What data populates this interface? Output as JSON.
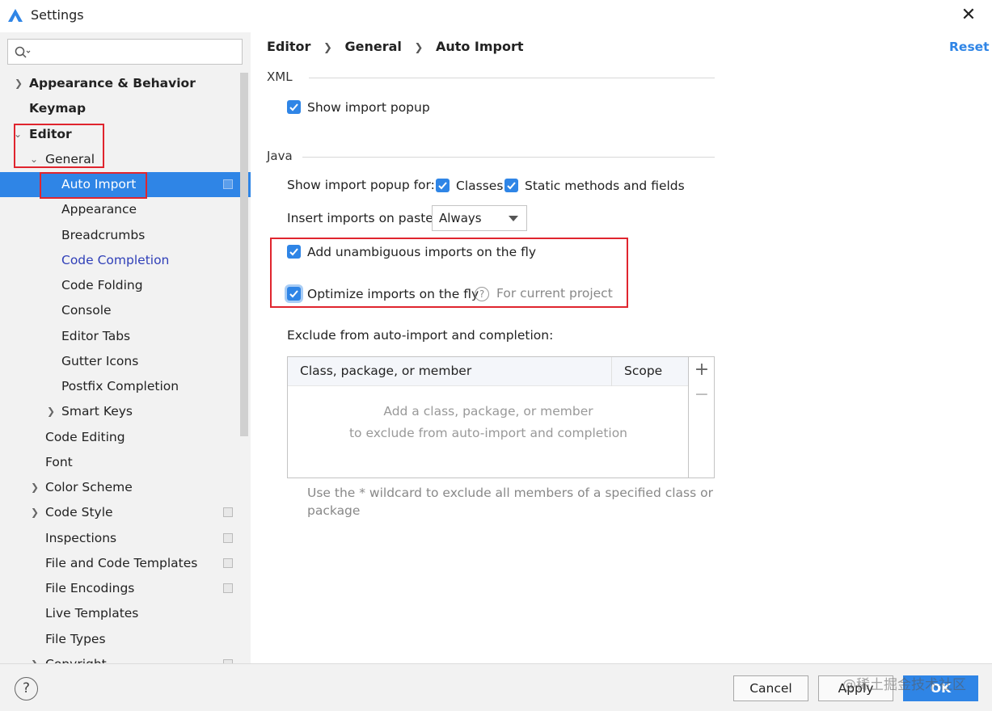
{
  "window": {
    "title": "Settings",
    "close_glyph": "✕"
  },
  "sidebar": {
    "search_placeholder": "",
    "items": [
      {
        "label": "Appearance & Behavior"
      },
      {
        "label": "Keymap"
      },
      {
        "label": "Editor"
      },
      {
        "label": "General"
      },
      {
        "label": "Auto Import"
      },
      {
        "label": "Appearance"
      },
      {
        "label": "Breadcrumbs"
      },
      {
        "label": "Code Completion"
      },
      {
        "label": "Code Folding"
      },
      {
        "label": "Console"
      },
      {
        "label": "Editor Tabs"
      },
      {
        "label": "Gutter Icons"
      },
      {
        "label": "Postfix Completion"
      },
      {
        "label": "Smart Keys"
      },
      {
        "label": "Code Editing"
      },
      {
        "label": "Font"
      },
      {
        "label": "Color Scheme"
      },
      {
        "label": "Code Style"
      },
      {
        "label": "Inspections"
      },
      {
        "label": "File and Code Templates"
      },
      {
        "label": "File Encodings"
      },
      {
        "label": "Live Templates"
      },
      {
        "label": "File Types"
      },
      {
        "label": "Copyright"
      }
    ]
  },
  "breadcrumb": [
    "Editor",
    "General",
    "Auto Import"
  ],
  "reset_label": "Reset",
  "xml": {
    "heading": "XML",
    "show_popup_label": "Show import popup"
  },
  "java": {
    "heading": "Java",
    "popup_for_label": "Show import popup for:",
    "classes_label": "Classes",
    "static_label": "Static methods and fields",
    "insert_label": "Insert imports on paste:",
    "insert_value": "Always",
    "add_unambiguous_label": "Add unambiguous imports on the fly",
    "optimize_label": "Optimize imports on the fly",
    "help_glyph": "?",
    "for_current_project": "For current project",
    "exclude_label": "Exclude from auto-import and completion:",
    "table": {
      "col1": "Class, package, or member",
      "col2": "Scope",
      "empty_line1": "Add a class, package, or member",
      "empty_line2": "to exclude from auto-import and completion",
      "add_glyph": "+",
      "remove_glyph": "−"
    },
    "hint_line1": "Use the * wildcard to exclude all members of a specified class or",
    "hint_line2": "package"
  },
  "footer": {
    "help_glyph": "?",
    "cancel": "Cancel",
    "apply": "Apply",
    "ok": "OK",
    "watermark": "@稀土掘金技术社区"
  },
  "colors": {
    "accent": "#2f85e6",
    "highlight_box": "#e0252e",
    "sidebar_bg": "#f2f2f2"
  },
  "icons": [
    "app-icon",
    "close-icon",
    "search-icon",
    "chevron-right-icon",
    "chevron-down-icon",
    "project-scope-icon",
    "help-icon",
    "add-icon",
    "remove-icon"
  ]
}
